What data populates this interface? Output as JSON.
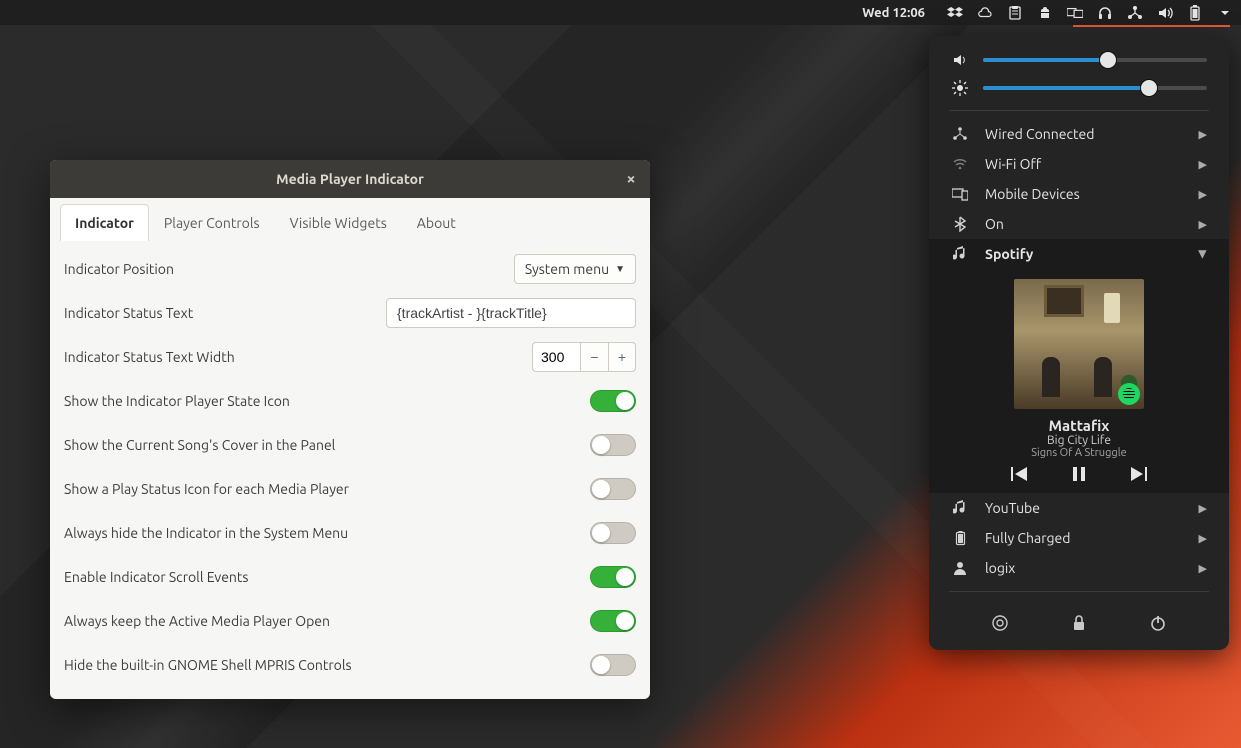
{
  "topbar": {
    "clock": "Wed 12:06"
  },
  "window": {
    "title": "Media Player Indicator",
    "tabs": [
      "Indicator",
      "Player Controls",
      "Visible Widgets",
      "About"
    ],
    "active_tab": 0,
    "indicator_position_label": "Indicator Position",
    "indicator_position_value": "System menu",
    "status_text_label": "Indicator Status Text",
    "status_text_value": "{trackArtist - }{trackTitle}",
    "status_width_label": "Indicator Status Text Width",
    "status_width_value": "300",
    "toggles": [
      {
        "label": "Show the Indicator Player State Icon",
        "on": true
      },
      {
        "label": "Show the Current Song's Cover in the Panel",
        "on": false
      },
      {
        "label": "Show a Play Status Icon for each Media Player",
        "on": false
      },
      {
        "label": "Always hide the Indicator in the System Menu",
        "on": false
      },
      {
        "label": "Enable Indicator Scroll Events",
        "on": true
      },
      {
        "label": "Always keep the Active Media Player Open",
        "on": true
      },
      {
        "label": "Hide the built-in GNOME Shell MPRIS Controls",
        "on": false
      }
    ]
  },
  "sysmenu": {
    "volume_percent": 56,
    "brightness_percent": 74,
    "items": [
      {
        "icon": "network-wired",
        "label": "Wired Connected"
      },
      {
        "icon": "wifi-off",
        "label": "Wi-Fi Off"
      },
      {
        "icon": "devices",
        "label": "Mobile Devices"
      },
      {
        "icon": "bluetooth",
        "label": "On"
      },
      {
        "icon": "music",
        "label": "Spotify",
        "expanded": true
      },
      {
        "icon": "music",
        "label": "YouTube"
      },
      {
        "icon": "battery",
        "label": "Fully Charged"
      },
      {
        "icon": "user",
        "label": "logix"
      }
    ],
    "player": {
      "artist": "Mattafix",
      "title": "Big City Life",
      "album": "Signs Of A Struggle"
    }
  }
}
